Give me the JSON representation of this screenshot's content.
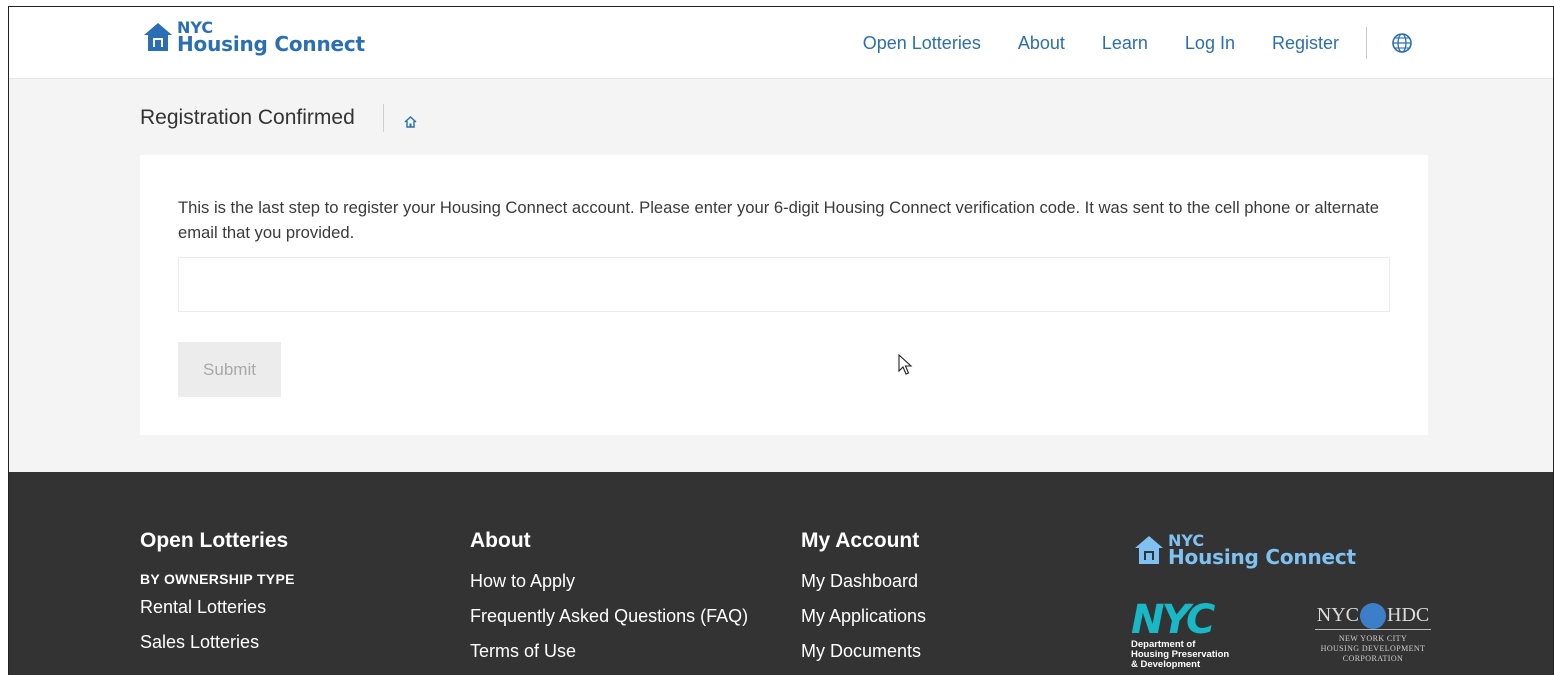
{
  "header": {
    "logo": {
      "line1": "NYC",
      "line2": "Housing Connect"
    },
    "nav": [
      {
        "label": "Open Lotteries"
      },
      {
        "label": "About"
      },
      {
        "label": "Learn"
      },
      {
        "label": "Log In"
      },
      {
        "label": "Register"
      }
    ],
    "language_icon": "globe-icon"
  },
  "breadcrumb": {
    "title": "Registration Confirmed",
    "home_icon": "home-icon"
  },
  "form": {
    "message": "This is the last step to register your Housing Connect account. Please enter your 6-digit Housing Connect verification code. It was sent to the cell phone or alternate email that you provided.",
    "code_value": "",
    "submit_label": "Submit"
  },
  "footer": {
    "open_lotteries": {
      "heading": "Open Lotteries",
      "subheading": "BY OWNERSHIP TYPE",
      "links": [
        "Rental Lotteries",
        "Sales Lotteries"
      ]
    },
    "about": {
      "heading": "About",
      "links": [
        "How to Apply",
        "Frequently Asked Questions (FAQ)",
        "Terms of Use"
      ]
    },
    "my_account": {
      "heading": "My Account",
      "links": [
        "My Dashboard",
        "My Applications",
        "My Documents"
      ]
    },
    "logo": {
      "line1": "NYC",
      "line2": "Housing Connect"
    },
    "hpd": {
      "mark": "NYC",
      "text_lines": [
        "Department of",
        "Housing Preservation",
        "& Development"
      ]
    },
    "hdc": {
      "mark_left": "NYC",
      "mark_right": "HDC",
      "text_lines": [
        "NEW YORK CITY",
        "HOUSING DEVELOPMENT",
        "CORPORATION"
      ]
    }
  },
  "colors": {
    "brand_blue": "#2a6fb4",
    "footer_bg": "#333333",
    "hpd_teal": "#18b8c6"
  }
}
